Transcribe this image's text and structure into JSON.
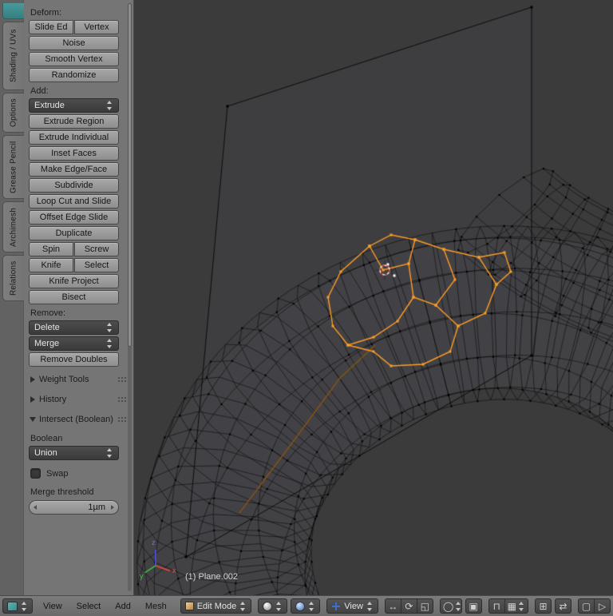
{
  "colors": {
    "selection_orange": "#ff9d26",
    "viewport_bg": "#3b3b3b",
    "accent_teal": "#3d8b8b"
  },
  "tabs": [
    "Shading / UVs",
    "Options",
    "Grease Pencil",
    "Archimesh",
    "Relations"
  ],
  "tools": {
    "deform_label": "Deform:",
    "slide_edge": "Slide Ed",
    "vertex": "Vertex",
    "noise": "Noise",
    "smooth_vertex": "Smooth Vertex",
    "randomize": "Randomize",
    "add_label": "Add:",
    "extrude": "Extrude",
    "extrude_region": "Extrude Region",
    "extrude_individual": "Extrude Individual",
    "inset_faces": "Inset Faces",
    "make_edge_face": "Make Edge/Face",
    "subdivide": "Subdivide",
    "loop_cut": "Loop Cut and Slide",
    "offset_edge_slide": "Offset Edge Slide",
    "duplicate": "Duplicate",
    "spin": "Spin",
    "screw": "Screw",
    "knife": "Knife",
    "select": "Select",
    "knife_project": "Knife Project",
    "bisect": "Bisect",
    "remove_label": "Remove:",
    "delete": "Delete",
    "merge": "Merge",
    "remove_doubles": "Remove Doubles",
    "weight_tools": "Weight Tools",
    "history": "History"
  },
  "boolean_panel": {
    "title": "Intersect (Boolean)",
    "boolean_label": "Boolean",
    "operation": "Union",
    "swap_label": "Swap",
    "threshold_label": "Merge threshold",
    "threshold_value": "1µm"
  },
  "viewport": {
    "object_info": "(1) Plane.002",
    "axis_x": "x",
    "axis_y": "y",
    "axis_z": "z"
  },
  "header": {
    "menu_view": "View",
    "menu_select": "Select",
    "menu_add": "Add",
    "menu_mesh": "Mesh",
    "mode": "Edit Mode",
    "orientation": "View"
  },
  "icons": {
    "manip_translate": "↔",
    "manip_rotate": "⟳",
    "manip_scale": "◱",
    "proportional": "◯",
    "occlude": "▣",
    "snap_magnet": "⊓",
    "snap_element": "▦",
    "layers": "⊞",
    "sync": "⇄",
    "render_still": "▢",
    "render_anim": "▷"
  }
}
